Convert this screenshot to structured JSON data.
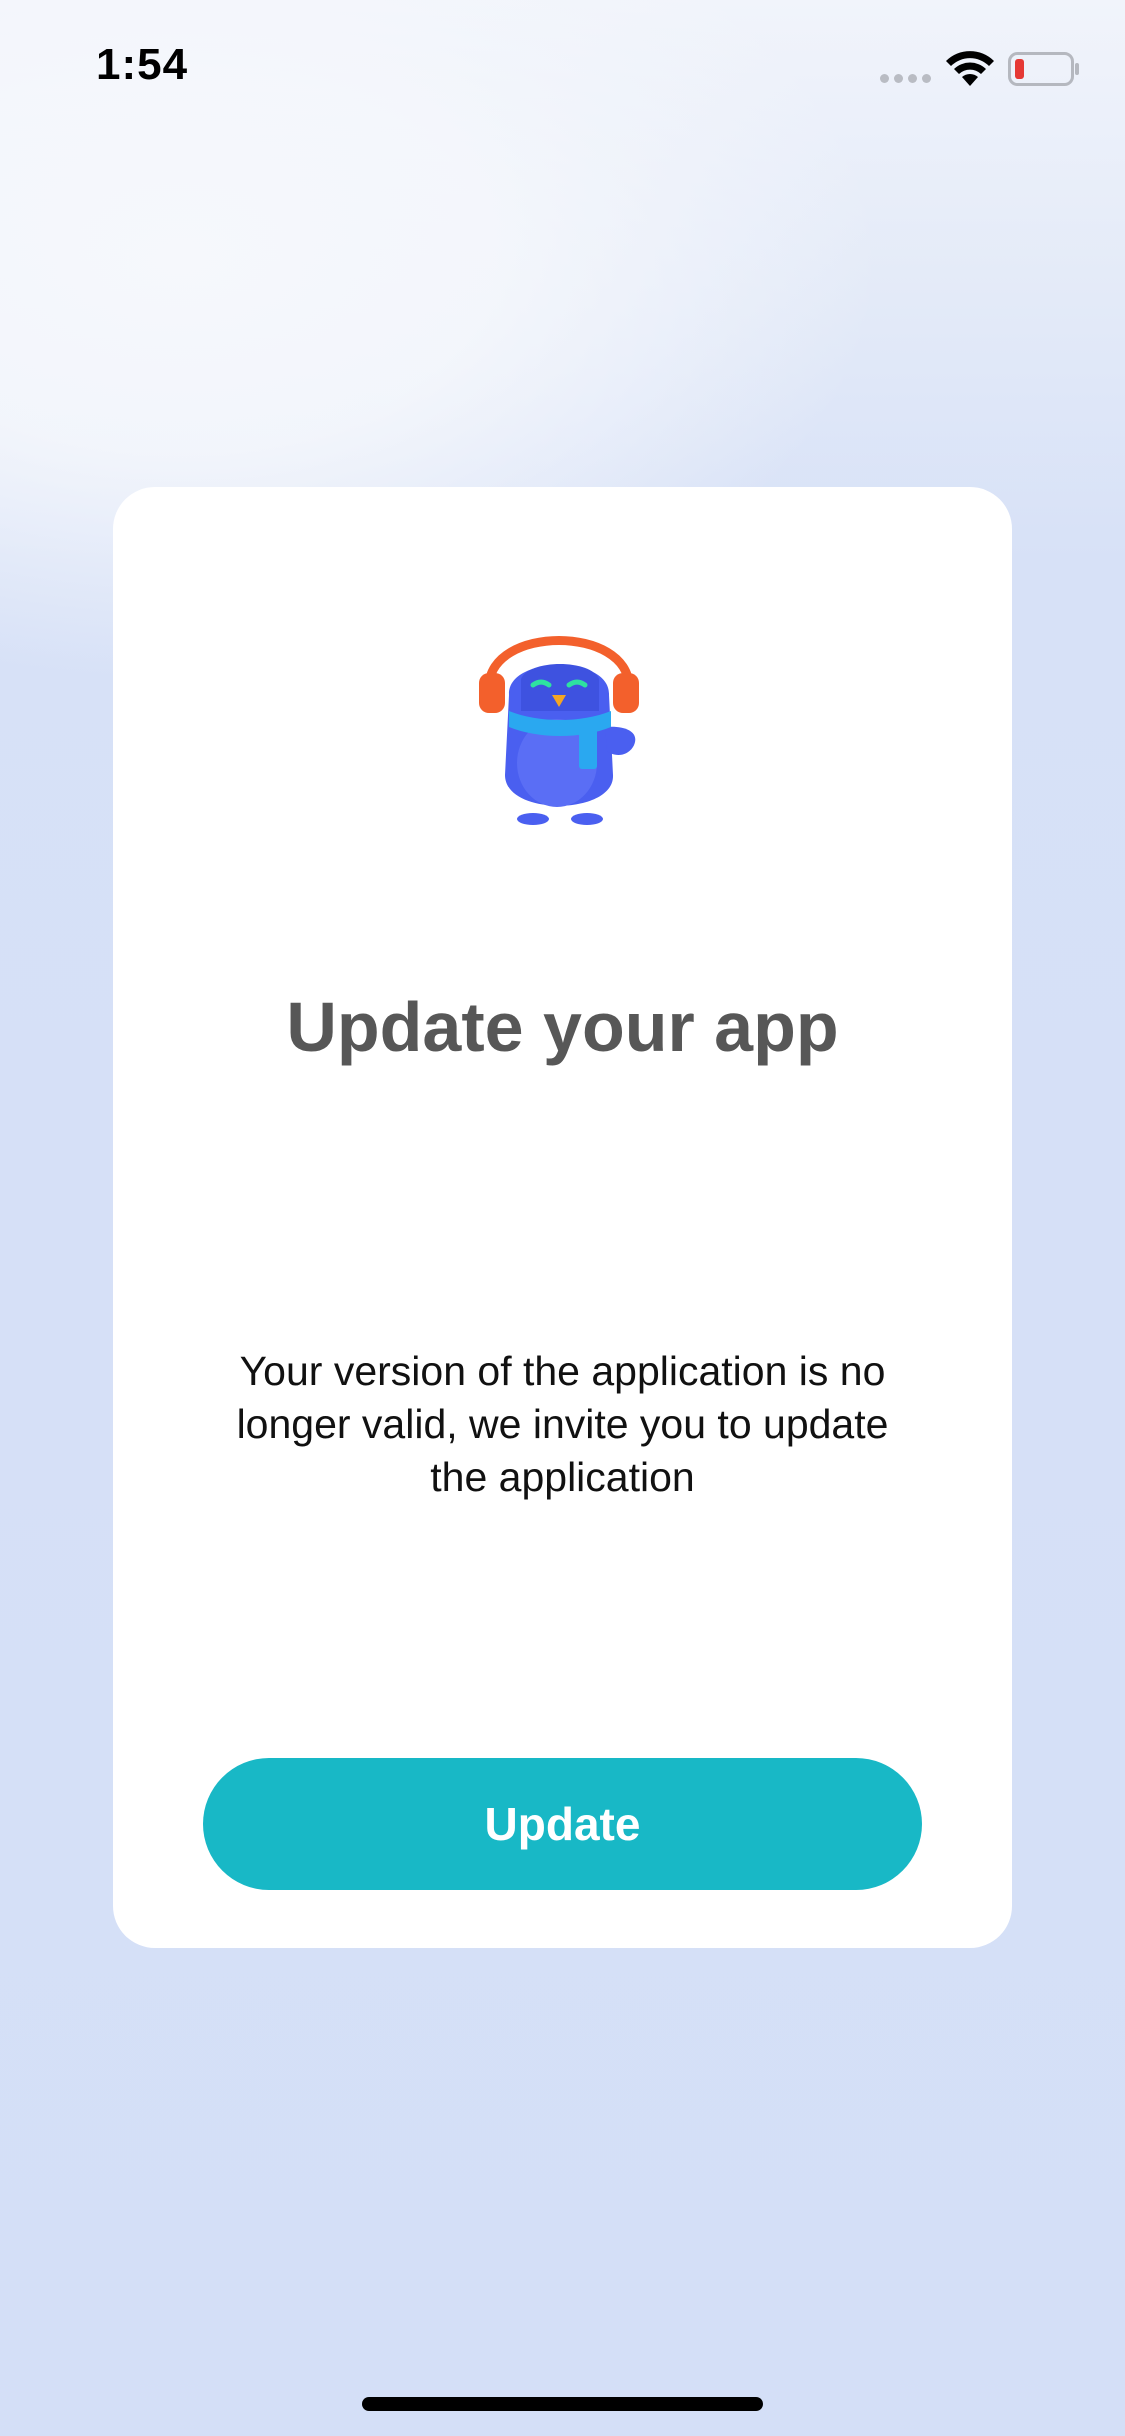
{
  "status_bar": {
    "time": "1:54",
    "icons": [
      "signal-icon",
      "wifi-icon",
      "battery-icon"
    ],
    "battery_color": "#e53935"
  },
  "dialog": {
    "mascot": "penguin-mascot-icon",
    "title": "Update your app",
    "message": "Your version of the application is no longer valid, we invite you to update the application",
    "button_label": "Update"
  },
  "colors": {
    "accent": "#18b8c6",
    "background": "#d5e0f7",
    "title": "#575757"
  }
}
